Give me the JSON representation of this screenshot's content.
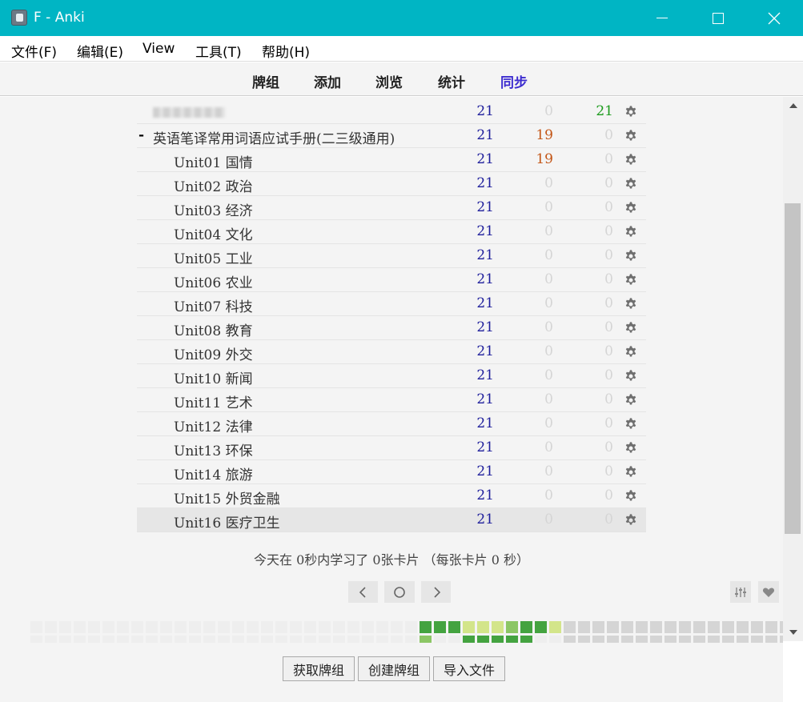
{
  "window": {
    "title": "F - Anki"
  },
  "menu": [
    {
      "label": "文件(F)"
    },
    {
      "label": "编辑(E)"
    },
    {
      "label": "View"
    },
    {
      "label": "工具(T)"
    },
    {
      "label": "帮助(H)"
    }
  ],
  "toolbar": [
    {
      "label": "牌组"
    },
    {
      "label": "添加"
    },
    {
      "label": "浏览"
    },
    {
      "label": "统计"
    },
    {
      "label": "同步"
    }
  ],
  "decks": [
    {
      "name": "",
      "blurred": true,
      "indent": 0,
      "new": "21",
      "learn": "0",
      "review": "21"
    },
    {
      "name": "英语笔译常用词语应试手册(二三级通用)",
      "collapse": "-",
      "indent": 0,
      "new": "21",
      "learn": "19",
      "review": "0"
    },
    {
      "name": "Unit01 国情",
      "indent": 1,
      "new": "21",
      "learn": "19",
      "review": "0"
    },
    {
      "name": "Unit02 政治",
      "indent": 1,
      "new": "21",
      "learn": "0",
      "review": "0"
    },
    {
      "name": "Unit03 经济",
      "indent": 1,
      "new": "21",
      "learn": "0",
      "review": "0"
    },
    {
      "name": "Unit04 文化",
      "indent": 1,
      "new": "21",
      "learn": "0",
      "review": "0"
    },
    {
      "name": "Unit05 工业",
      "indent": 1,
      "new": "21",
      "learn": "0",
      "review": "0"
    },
    {
      "name": "Unit06 农业",
      "indent": 1,
      "new": "21",
      "learn": "0",
      "review": "0"
    },
    {
      "name": "Unit07 科技",
      "indent": 1,
      "new": "21",
      "learn": "0",
      "review": "0"
    },
    {
      "name": "Unit08 教育",
      "indent": 1,
      "new": "21",
      "learn": "0",
      "review": "0"
    },
    {
      "name": "Unit09 外交",
      "indent": 1,
      "new": "21",
      "learn": "0",
      "review": "0"
    },
    {
      "name": "Unit10 新闻",
      "indent": 1,
      "new": "21",
      "learn": "0",
      "review": "0"
    },
    {
      "name": "Unit11 艺术",
      "indent": 1,
      "new": "21",
      "learn": "0",
      "review": "0"
    },
    {
      "name": "Unit12 法律",
      "indent": 1,
      "new": "21",
      "learn": "0",
      "review": "0"
    },
    {
      "name": "Unit13 环保",
      "indent": 1,
      "new": "21",
      "learn": "0",
      "review": "0"
    },
    {
      "name": "Unit14 旅游",
      "indent": 1,
      "new": "21",
      "learn": "0",
      "review": "0"
    },
    {
      "name": "Unit15 外贸金融",
      "indent": 1,
      "new": "21",
      "learn": "0",
      "review": "0"
    },
    {
      "name": "Unit16 医疗卫生",
      "indent": 1,
      "new": "21",
      "learn": "0",
      "review": "0",
      "current": true
    }
  ],
  "summary": "今天在 0秒内学习了 0张卡片 （每张卡片 0 秒）",
  "icons": {
    "gear": "gear-icon",
    "prev": "chevron-left-icon",
    "today": "circle-icon",
    "next": "chevron-right-icon",
    "options": "sliders-icon",
    "donate": "heart-icon"
  },
  "heatmap": {
    "levels": [
      "#e6e6e6",
      "#d3e58a",
      "#8cc665",
      "#44a340",
      "#1e8a31"
    ],
    "past_empty": "#eeeeee",
    "future": "#d5d5d5",
    "top_row": [
      0,
      0,
      0,
      0,
      0,
      0,
      0,
      0,
      0,
      0,
      0,
      0,
      0,
      0,
      0,
      0,
      0,
      0,
      0,
      0,
      0,
      0,
      0,
      0,
      0,
      0,
      0,
      3,
      3,
      3,
      1,
      1,
      1,
      2,
      3,
      3,
      1,
      "f",
      "f",
      "f",
      "f",
      "f",
      "f",
      "f",
      "f",
      "f",
      "f",
      "f",
      "f",
      "f",
      "f",
      "f",
      "f",
      "f",
      null,
      "f",
      "f",
      "f"
    ],
    "bottom_row": [
      0,
      0,
      0,
      0,
      0,
      0,
      0,
      0,
      0,
      0,
      0,
      0,
      0,
      0,
      0,
      0,
      0,
      0,
      0,
      0,
      0,
      0,
      0,
      0,
      0,
      0,
      0,
      2,
      0,
      0,
      3,
      3,
      3,
      3,
      3,
      0,
      0,
      "f",
      "f",
      "f",
      "f",
      "f",
      "f",
      "f",
      "f",
      "f",
      "f",
      "f",
      "f",
      "f",
      "f",
      "f",
      "f",
      "f",
      null,
      "f",
      "f",
      "f"
    ]
  },
  "buttons": {
    "get_shared": "获取牌组",
    "create_deck": "创建牌组",
    "import_file": "导入文件"
  }
}
